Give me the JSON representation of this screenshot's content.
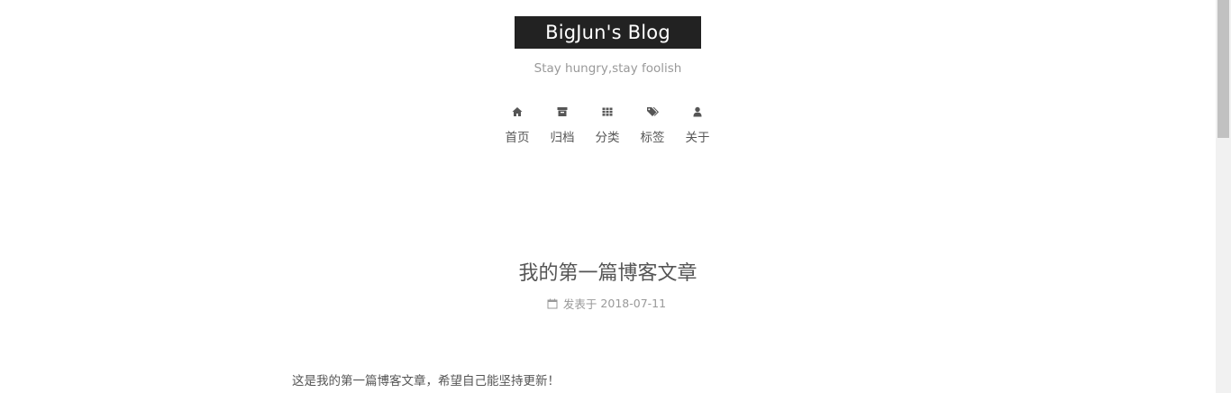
{
  "site": {
    "title": "BigJun's Blog",
    "subtitle": "Stay hungry,stay foolish"
  },
  "menu": {
    "items": [
      {
        "label": "首页",
        "icon": "home-icon"
      },
      {
        "label": "归档",
        "icon": "archive-icon"
      },
      {
        "label": "分类",
        "icon": "th-icon"
      },
      {
        "label": "标签",
        "icon": "tags-icon"
      },
      {
        "label": "关于",
        "icon": "user-icon"
      }
    ]
  },
  "post": {
    "title": "我的第一篇博客文章",
    "meta_label": "发表于",
    "date": "2018-07-11",
    "body": "这是我的第一篇博客文章，希望自己能坚持更新！"
  },
  "colors": {
    "brand_bg": "#222222",
    "text": "#555555",
    "muted": "#999999"
  }
}
